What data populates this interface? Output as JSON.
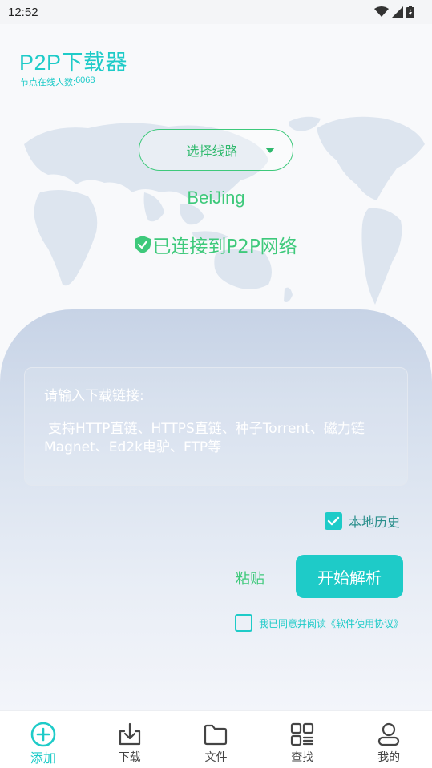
{
  "status_bar": {
    "time": "12:52",
    "icons": [
      "wifi-icon",
      "signal-icon",
      "battery-charging-icon"
    ]
  },
  "header": {
    "title": "P2P下载器",
    "online_label": "节点在线人数:",
    "online_count": "6068"
  },
  "route": {
    "label": "选择线路",
    "city": "BeiJing",
    "status": "已连接到P2P网络",
    "status_icon": "shield-check-icon"
  },
  "input": {
    "label": "请输入下载链接:",
    "hint": "支持HTTP直链、HTTPS直链、种子Torrent、磁力链Magnet、Ed2k电驴、FTP等"
  },
  "history": {
    "label": "本地历史",
    "checked": true
  },
  "actions": {
    "paste_label": "粘贴",
    "start_label": "开始解析"
  },
  "agreement": {
    "label": "我已同意并阅读《软件使用协议》",
    "checked": false
  },
  "nav": {
    "items": [
      {
        "label": "添加",
        "icon": "add-circle-icon",
        "active": true
      },
      {
        "label": "下载",
        "icon": "download-icon",
        "active": false
      },
      {
        "label": "文件",
        "icon": "folder-icon",
        "active": false
      },
      {
        "label": "查找",
        "icon": "grid-search-icon",
        "active": false
      },
      {
        "label": "我的",
        "icon": "user-icon",
        "active": false
      }
    ]
  },
  "colors": {
    "accent": "#1ecbc8",
    "green": "#3ec97b",
    "panel_top": "#c7d3e6",
    "map": "#dde5ef"
  }
}
